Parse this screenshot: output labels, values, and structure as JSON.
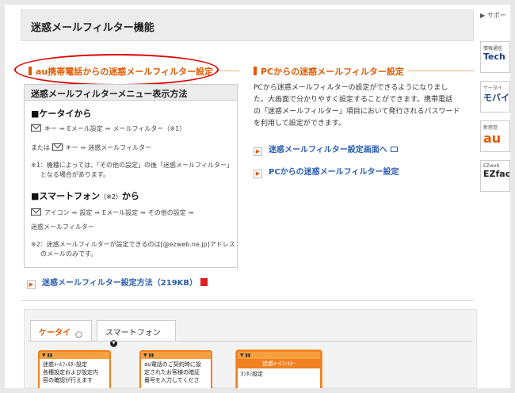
{
  "page": {
    "title": "迷惑メールフィルター機能"
  },
  "au_section": {
    "title": "au携帯電話からの迷惑メールフィルター設定",
    "box_title": "迷惑メールフィルターメニュー表示方法",
    "keitai": {
      "heading": "■ケータイから",
      "path1": [
        "キー",
        "Eメール設定",
        "メールフィルター（※1）"
      ],
      "or_label": "または",
      "path2": [
        "キー",
        "迷惑メールフィルター"
      ],
      "note1_a": "※1：機種によっては、「その他の設定」の後「迷惑メールフィルター」",
      "note1_b": "となる場合があります。"
    },
    "smartphone": {
      "heading": "■スマートフォン",
      "heading_note": "（※2）",
      "heading_suffix": "から",
      "path": [
        "アイコン",
        "設定",
        "Eメール設定",
        "その他の設定"
      ],
      "path_end": "迷惑メールフィルター",
      "note2_a": "※2：迷惑メールフィルターが設定できるのは[@ezweb.ne.jp]アドレス",
      "note2_b": "のメールのみです。"
    },
    "pdf_link": "迷惑メールフィルター設定方法（219KB）"
  },
  "pc_section": {
    "title": "PCからの迷惑メールフィルター設定",
    "description": [
      "PCから迷惑メールフィルターの設定ができるようになりまし",
      "た。大画面で分かりやすく設定することができます。携帯電話",
      "の「迷惑メールフィルター」項目において発行されるパスワード",
      "を利用して設定ができます。"
    ],
    "link1": "迷惑メールフィルター設定画面へ",
    "link2": "PCからの迷惑メールフィルター設定"
  },
  "tabs": [
    {
      "label": "ケータイ",
      "active": true
    },
    {
      "label": "スマートフォン",
      "active": false
    }
  ],
  "phones": [
    {
      "lines": [
        "迷惑ﾒｰﾙﾌｨﾙﾀｰ設定",
        "各種設定および設定内",
        "容の確認が行えます"
      ]
    },
    {
      "lines": [
        "au電話のご契約時に設",
        "定されたお客様の暗証",
        "番号を入力してくださ"
      ]
    },
    {
      "title": "迷惑ﾒｰﾙﾌｨﾙﾀｰ",
      "lines": [
        "ｶﾝﾀﾝ設定"
      ]
    }
  ],
  "side": {
    "support": "サポー",
    "ads": [
      {
        "small": "情報通信",
        "big": "Tech"
      },
      {
        "small": "ケータイ",
        "big": "モバイ"
      },
      {
        "small": "新感覚",
        "big": "au"
      },
      {
        "small": "EZweb",
        "big": "EZfac"
      }
    ]
  },
  "colors": {
    "accent": "#e05a00",
    "link": "#2a5db0",
    "highlight": "#e00000"
  }
}
